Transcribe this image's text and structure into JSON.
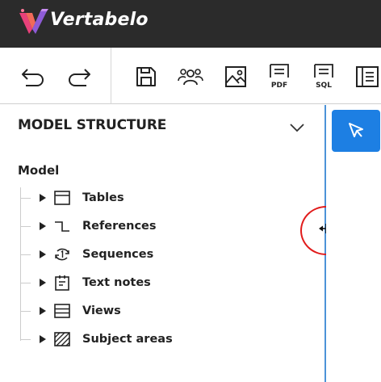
{
  "app": {
    "brand_name": "Vertabelo",
    "logo_icon": "vertabelo-logo-icon",
    "colors": {
      "topbar": "#2b2b2b",
      "accent": "#1d7fe3",
      "splitter": "#4c93d8",
      "highlight": "#e11b1b"
    }
  },
  "toolbar": {
    "buttons": [
      {
        "name": "undo",
        "icon": "undo-icon"
      },
      {
        "name": "redo",
        "icon": "redo-icon"
      },
      {
        "name": "save",
        "icon": "save-icon"
      },
      {
        "name": "share",
        "icon": "users-icon"
      },
      {
        "name": "export-image",
        "icon": "image-icon"
      },
      {
        "name": "export-pdf",
        "icon": "pdf-icon",
        "label": "PDF"
      },
      {
        "name": "export-sql",
        "icon": "sql-icon",
        "label": "SQL"
      },
      {
        "name": "more",
        "icon": "panel-icon"
      }
    ]
  },
  "panel": {
    "title": "MODEL STRUCTURE",
    "collapse_icon": "chevron-down-icon",
    "model_label": "Model",
    "items": [
      {
        "label": "Tables",
        "icon": "table-icon"
      },
      {
        "label": "References",
        "icon": "reference-icon"
      },
      {
        "label": "Sequences",
        "icon": "sequence-icon"
      },
      {
        "label": "Text notes",
        "icon": "text-note-icon"
      },
      {
        "label": "Views",
        "icon": "view-icon"
      },
      {
        "label": "Subject areas",
        "icon": "subject-area-icon"
      }
    ]
  },
  "tools": {
    "select_icon": "select-cursor-icon"
  }
}
